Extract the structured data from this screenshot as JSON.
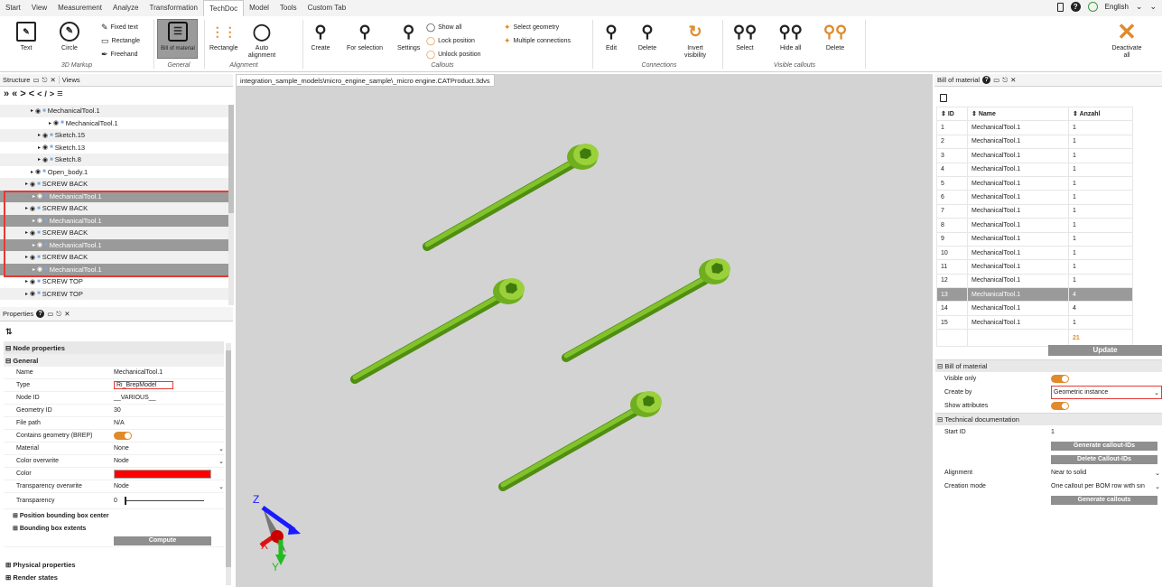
{
  "menu": {
    "items": [
      "Start",
      "View",
      "Measurement",
      "Analyze",
      "Transformation",
      "TechDoc",
      "Model",
      "Tools",
      "Custom Tab"
    ],
    "language": "English"
  },
  "ribbon": {
    "markup": {
      "text": "Text",
      "circle": "Circle",
      "fixed_text": "Fixed text",
      "rectangle": "Rectangle",
      "freehand": "Freehand",
      "group": "3D Markup"
    },
    "general": {
      "bom": "Bill of material",
      "group": "General"
    },
    "alignment": {
      "rectangle": "Rectangle",
      "auto": "Auto alignment",
      "group": "Alignment"
    },
    "callouts": {
      "create": "Create",
      "for_selection": "For selection",
      "settings": "Settings",
      "show_all": "Show all",
      "lock_position": "Lock position",
      "unlock_position": "Unlock position",
      "select_geometry": "Select geometry",
      "multiple_connections": "Multiple connections",
      "group": "Callouts"
    },
    "connections": {
      "edit": "Edit",
      "delete": "Delete",
      "invert": "Invert visibility",
      "group": "Connections"
    },
    "visible": {
      "select": "Select",
      "hide_all": "Hide all",
      "delete": "Delete",
      "group": "Visible callouts"
    },
    "deactivate": "Deactivate all"
  },
  "structure": {
    "tab_structure": "Structure",
    "tab_views": "Views",
    "tree": [
      {
        "label": "MechanicalTool.1",
        "indent": 34,
        "alt": true,
        "sel": false,
        "icon": "eye"
      },
      {
        "label": "MechanicalTool.1",
        "indent": 54,
        "alt": false,
        "sel": false,
        "icon": "eye"
      },
      {
        "label": "Sketch.15",
        "indent": 42,
        "alt": true,
        "sel": false,
        "icon": "eye"
      },
      {
        "label": "Sketch.13",
        "indent": 42,
        "alt": false,
        "sel": false,
        "icon": "eye"
      },
      {
        "label": "Sketch.8",
        "indent": 42,
        "alt": true,
        "sel": false,
        "icon": "eye"
      },
      {
        "label": "Open_body.1",
        "indent": 34,
        "alt": false,
        "sel": false,
        "icon": "eye"
      },
      {
        "label": "SCREW BACK",
        "indent": 28,
        "alt": true,
        "sel": false,
        "icon": "eye"
      },
      {
        "label": "MechanicalTool.1",
        "indent": 36,
        "alt": false,
        "sel": true,
        "icon": "eye"
      },
      {
        "label": "SCREW BACK",
        "indent": 28,
        "alt": true,
        "sel": false,
        "icon": "eye"
      },
      {
        "label": "MechanicalTool.1",
        "indent": 36,
        "alt": false,
        "sel": true,
        "icon": "eye"
      },
      {
        "label": "SCREW BACK",
        "indent": 28,
        "alt": true,
        "sel": false,
        "icon": "eye"
      },
      {
        "label": "MechanicalTool.1",
        "indent": 36,
        "alt": false,
        "sel": true,
        "icon": "eye"
      },
      {
        "label": "SCREW BACK",
        "indent": 28,
        "alt": true,
        "sel": false,
        "icon": "eye"
      },
      {
        "label": "MechanicalTool.1",
        "indent": 36,
        "alt": false,
        "sel": true,
        "icon": "eye"
      },
      {
        "label": "SCREW TOP",
        "indent": 28,
        "alt": false,
        "sel": false,
        "icon": "eye"
      },
      {
        "label": "SCREW TOP",
        "indent": 28,
        "alt": true,
        "sel": false,
        "icon": "eye"
      }
    ]
  },
  "properties": {
    "tab": "Properties",
    "node_properties": "Node properties",
    "general": "General",
    "rows": [
      {
        "name": "Name",
        "value": "MechanicalTool.1"
      },
      {
        "name": "Type",
        "value": "Ri_BrepModel"
      },
      {
        "name": "Node ID",
        "value": "__VARIOUS__"
      },
      {
        "name": "Geometry ID",
        "value": "30"
      },
      {
        "name": "File path",
        "value": "N/A"
      },
      {
        "name": "Contains geometry (BREP)",
        "value": ""
      },
      {
        "name": "Material",
        "value": "None"
      },
      {
        "name": "Color overwrite",
        "value": "Node"
      },
      {
        "name": "Color",
        "value": ""
      },
      {
        "name": "Transparency overwrite",
        "value": "Node"
      },
      {
        "name": "Transparency",
        "value": "0"
      }
    ],
    "position_bbox": "Position bounding box center",
    "bbox_extents": "Bounding box extents",
    "compute": "Compute",
    "physical": "Physical properties",
    "render_states": "Render states",
    "color_value": "#ff0000"
  },
  "viewport": {
    "tab": "integration_sample_models\\micro_engine_sample\\_micro engine.CATProduct.3dvs",
    "axis_z": "Z",
    "axis_x": "X",
    "axis_y": "Y"
  },
  "bom": {
    "tab": "Bill of material",
    "col_id": "ID",
    "col_name": "Name",
    "col_count": "Anzahl",
    "rows": [
      {
        "id": "1",
        "name": "MechanicalTool.1",
        "count": "1"
      },
      {
        "id": "2",
        "name": "MechanicalTool.1",
        "count": "1"
      },
      {
        "id": "3",
        "name": "MechanicalTool.1",
        "count": "1"
      },
      {
        "id": "4",
        "name": "MechanicalTool.1",
        "count": "1"
      },
      {
        "id": "5",
        "name": "MechanicalTool.1",
        "count": "1"
      },
      {
        "id": "6",
        "name": "MechanicalTool.1",
        "count": "1"
      },
      {
        "id": "7",
        "name": "MechanicalTool.1",
        "count": "1"
      },
      {
        "id": "8",
        "name": "MechanicalTool.1",
        "count": "1"
      },
      {
        "id": "9",
        "name": "MechanicalTool.1",
        "count": "1"
      },
      {
        "id": "10",
        "name": "MechanicalTool.1",
        "count": "1"
      },
      {
        "id": "11",
        "name": "MechanicalTool.1",
        "count": "1"
      },
      {
        "id": "12",
        "name": "MechanicalTool.1",
        "count": "1"
      },
      {
        "id": "13",
        "name": "MechanicalTool.1",
        "count": "4"
      },
      {
        "id": "14",
        "name": "MechanicalTool.1",
        "count": "4"
      },
      {
        "id": "15",
        "name": "MechanicalTool.1",
        "count": "1"
      }
    ],
    "selected_row": "13",
    "total": "21",
    "update": "Update",
    "section_bom": "Bill of material",
    "visible_only": "Visible only",
    "create_by": "Create by",
    "create_by_value": "Geometric instance",
    "show_attributes": "Show attributes",
    "section_techdoc": "Technical documentation",
    "start_id": "Start ID",
    "start_id_value": "1",
    "generate_ids": "Generate callout-IDs",
    "delete_ids": "Delete Callout-IDs",
    "alignment": "Alignment",
    "alignment_value": "Near to solid",
    "creation_mode": "Creation mode",
    "creation_mode_value": "One callout per BOM row with sin",
    "generate_callouts": "Generate callouts"
  }
}
